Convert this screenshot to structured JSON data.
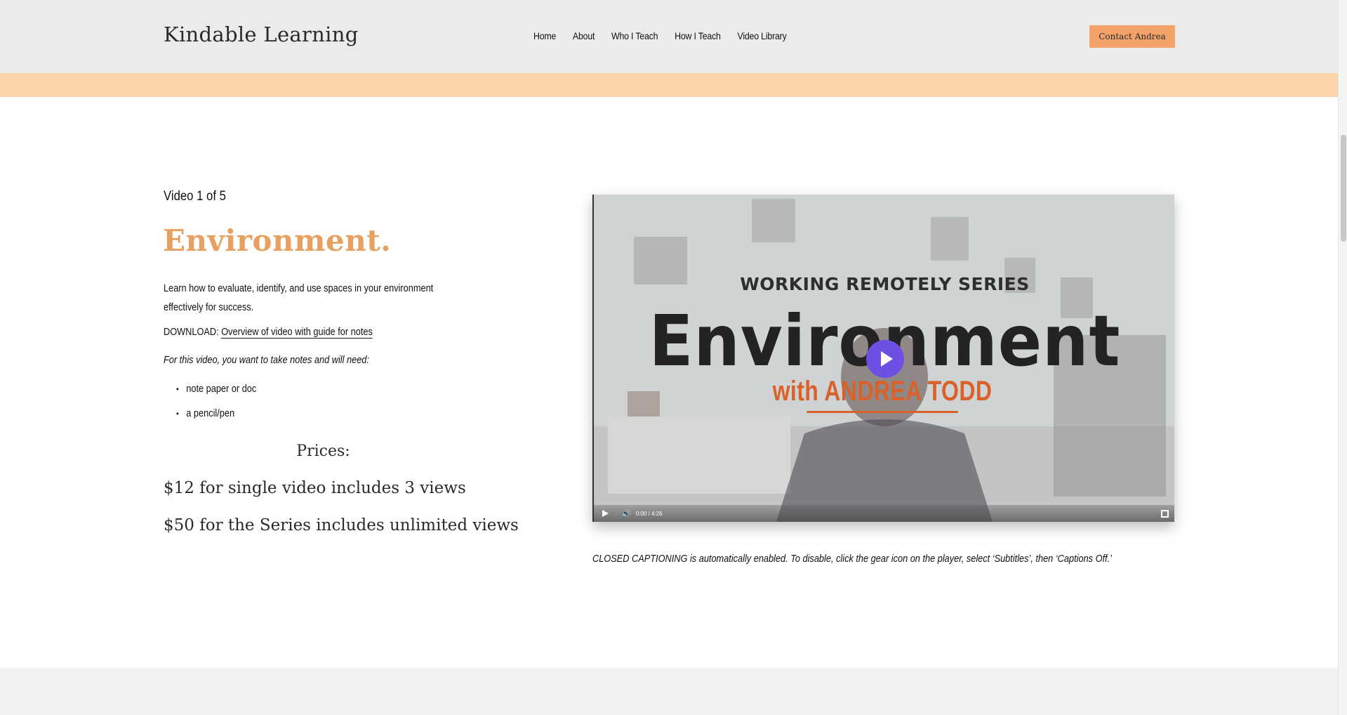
{
  "header": {
    "brand": "Kindable Learning",
    "nav": [
      "Home",
      "About",
      "Who I Teach",
      "How I Teach",
      "Video Library"
    ],
    "contact_label": "Contact Andrea"
  },
  "video_info": {
    "counter": "Video 1 of 5",
    "title": "Environment.",
    "description": " Learn how to evaluate, identify, and use spaces in your environment effectively for success.",
    "download_prefix": "DOWNLOAD: ",
    "download_link": "Overview of video with guide for notes",
    "need_text": "For this video, you want to take notes and will need:",
    "needs": [
      "note paper or doc",
      "a pencil/pen"
    ]
  },
  "prices": {
    "heading": "Prices:",
    "single": "$12 for single video includes 3 views",
    "series": "$50 for the Series includes unlimited views"
  },
  "player": {
    "series_text": "WORKING REMOTELY SERIES",
    "title_text": "Environment",
    "presenter_text": "with ANDREA TODD",
    "time": "0:00 / 4:26",
    "play_icon": "play-icon",
    "volume_icon": "volume-icon",
    "fullscreen_icon": "fullscreen-icon"
  },
  "caption_note": "CLOSED CAPTIONING is automatically enabled. To disable, click the gear icon on the player, select ‘Subtitles’, then ‘Captions Off.’",
  "colors": {
    "accent": "#e8a060",
    "button": "#f3a268",
    "band": "#fdd3ab",
    "play": "#6d4fe3",
    "presenter": "#d9622a"
  }
}
